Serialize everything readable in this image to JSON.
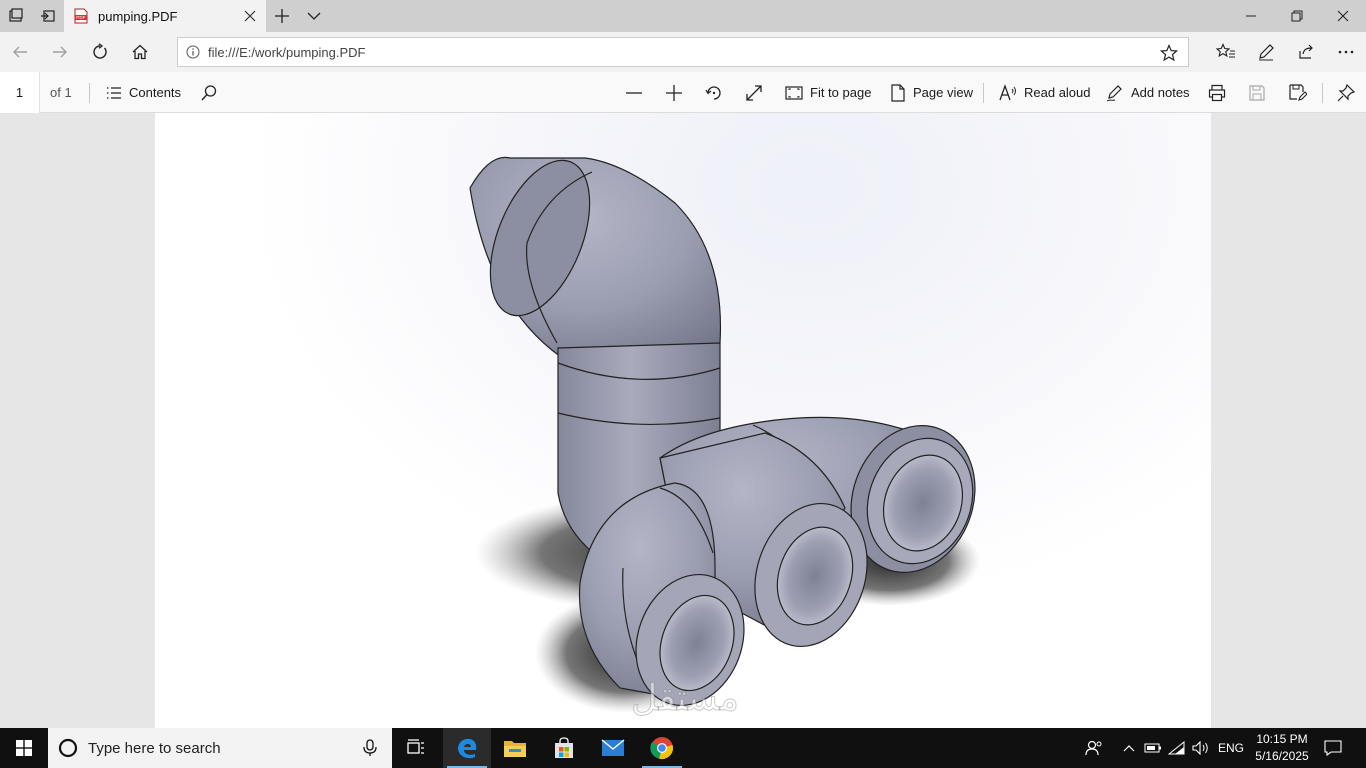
{
  "tab": {
    "title": "pumping.PDF",
    "icon": "pdf-file-icon"
  },
  "address": {
    "url": "file:///E:/work/pumping.PDF"
  },
  "pdf_toolbar": {
    "page_number": "1",
    "page_of": "of 1",
    "contents_label": "Contents",
    "fit_to_page_label": "Fit to page",
    "page_view_label": "Page view",
    "read_aloud_label": "Read aloud",
    "add_notes_label": "Add notes"
  },
  "document": {
    "content": "3D CAD render of grey pipe assembly",
    "model_color": "#9a9cb0",
    "shadow_color": "#2a2a2a"
  },
  "watermark": {
    "arabic": "مستقل",
    "latin": "mostaql.com"
  },
  "taskbar": {
    "search_placeholder": "Type here to search",
    "language": "ENG",
    "time": "10:15 PM",
    "date": "5/16/2025"
  },
  "colors": {
    "tab_strip": "#cfcfcf",
    "toolbar": "#f2f2f2",
    "taskbar": "#101010",
    "edge_blue": "#1b6ec2"
  }
}
